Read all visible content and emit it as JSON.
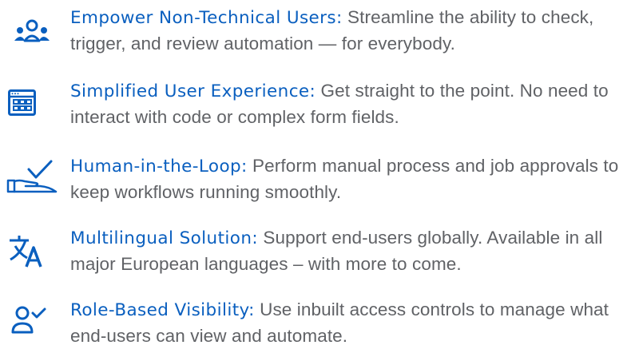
{
  "features": [
    {
      "icon": "users-group-icon",
      "title": "Empower Non-Technical Users:",
      "body": " Streamline the ability to check, trigger, and review automation — for everybody."
    },
    {
      "icon": "app-grid-window-icon",
      "title": "Simplified User Experience:",
      "body": " Get straight to the point. No need to interact with code or complex form fields."
    },
    {
      "icon": "hand-checkmark-icon",
      "title": "Human-in-the-Loop:",
      "body": " Perform manual process and job approvals to keep workflows running smoothly."
    },
    {
      "icon": "translate-icon",
      "title": "Multilingual Solution:",
      "body": " Support end-users globally. Available in all major European languages – with more to come."
    },
    {
      "icon": "user-check-icon",
      "title": "Role-Based Visibility:",
      "body": " Use inbuilt access controls to manage what end-users can view and automate."
    }
  ],
  "colors": {
    "accent": "#0a5fbf",
    "body_text": "#606266"
  }
}
